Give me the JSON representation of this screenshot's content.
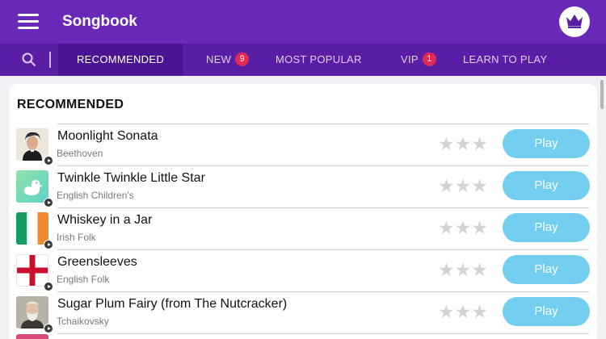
{
  "header": {
    "title": "Songbook",
    "menu_icon": "hamburger-menu-icon",
    "vip_icon": "crown-icon",
    "colors": {
      "bar": "#6a28b8",
      "tabbar": "#5a1ea6",
      "active_tab": "#4a1494"
    }
  },
  "tabs": [
    {
      "label": "RECOMMENDED",
      "active": true
    },
    {
      "label": "NEW",
      "badge": "9"
    },
    {
      "label": "MOST POPULAR"
    },
    {
      "label": "VIP",
      "badge": "1"
    },
    {
      "label": "LEARN TO PLAY"
    }
  ],
  "section": {
    "title": "RECOMMENDED"
  },
  "songs": [
    {
      "title": "Moonlight Sonata",
      "artist": "Beethoven",
      "thumb": "beethoven-portrait",
      "stars": 0,
      "play_label": "Play"
    },
    {
      "title": "Twinkle Twinkle Little Star",
      "artist": "English Children's",
      "thumb": "duck",
      "stars": 0,
      "play_label": "Play"
    },
    {
      "title": "Whiskey in a Jar",
      "artist": "Irish Folk",
      "thumb": "irish-flag",
      "stars": 0,
      "play_label": "Play"
    },
    {
      "title": "Greensleeves",
      "artist": "English Folk",
      "thumb": "english-flag",
      "stars": 0,
      "play_label": "Play"
    },
    {
      "title": "Sugar Plum Fairy (from The Nutcracker)",
      "artist": "Tchaikovsky",
      "thumb": "tchaikovsky-portrait",
      "stars": 0,
      "play_label": "Play"
    }
  ],
  "colors": {
    "play_button": "#73cdee",
    "badge": "#e22a55",
    "star_empty": "#d3d3d3"
  }
}
